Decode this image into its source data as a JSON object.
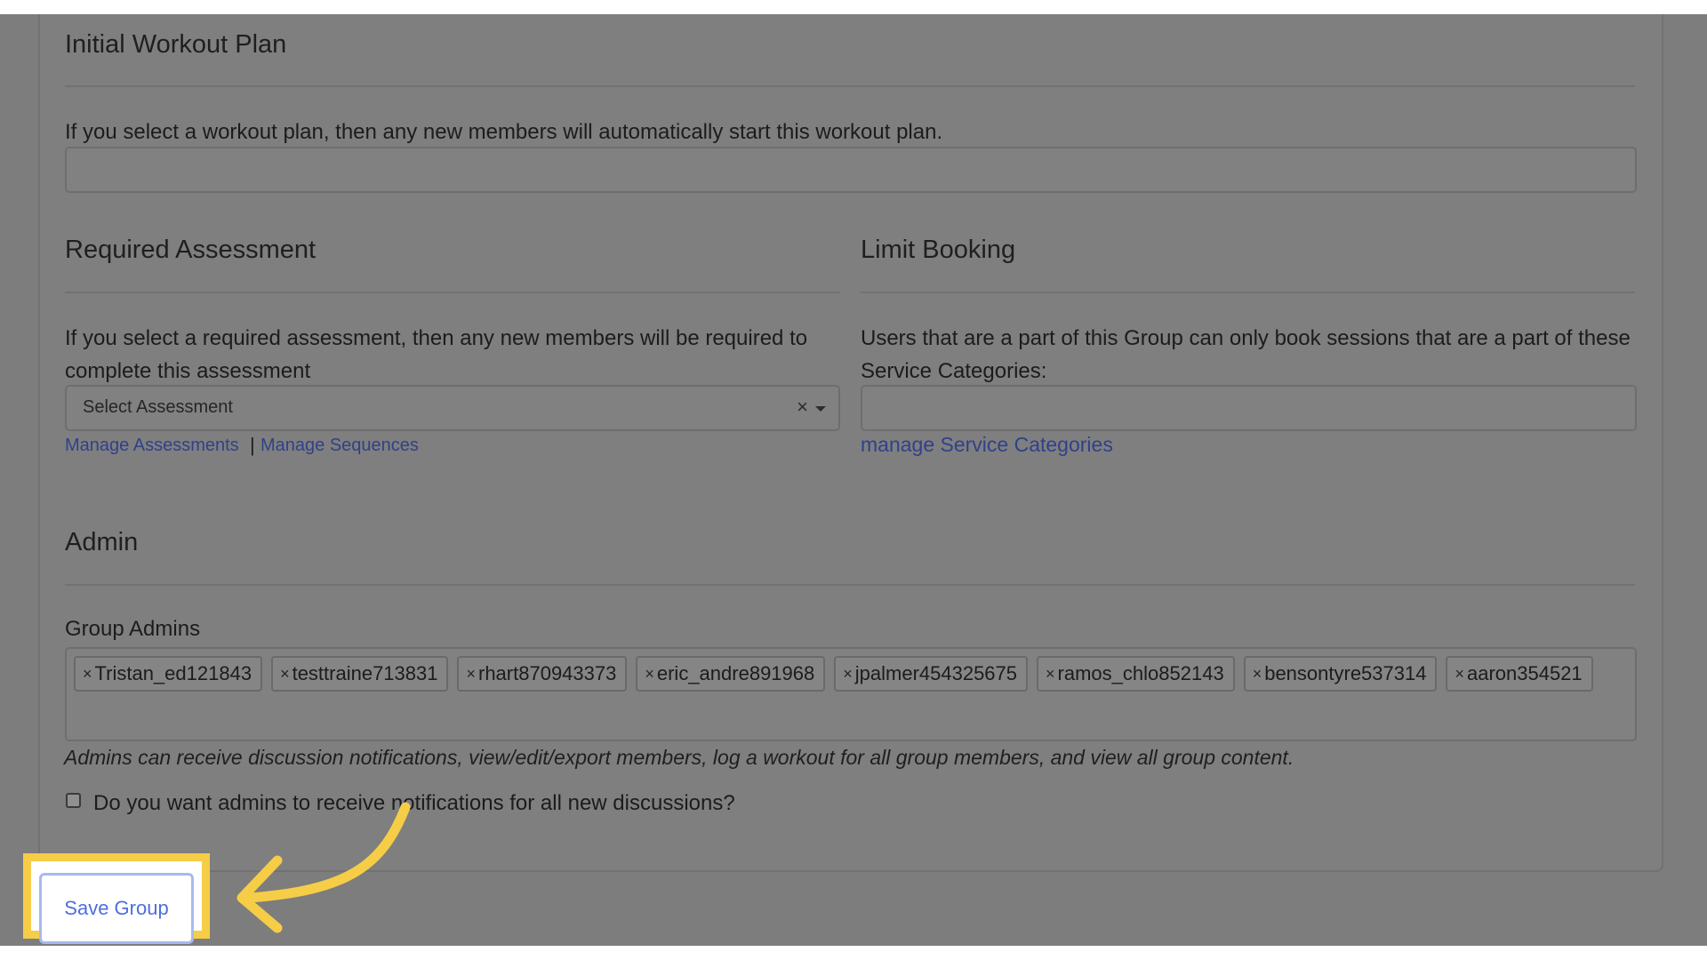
{
  "workout": {
    "heading": "Initial Workout Plan",
    "description": "If you select a workout plan, then any new members will automatically start this workout plan.",
    "input_value": ""
  },
  "assessment": {
    "heading": "Required Assessment",
    "description": "If you select a required assessment, then any new members will be required to complete this assessment",
    "select_placeholder": "Select Assessment",
    "clear_glyph": "×",
    "link_manage_assessments": "Manage Assessments",
    "separator": "|",
    "link_manage_sequences": "Manage Sequences"
  },
  "limit_booking": {
    "heading": "Limit Booking",
    "description": "Users that are a part of this Group can only book sessions that are a part of these Service Categories:",
    "input_value": "",
    "link_manage_service_categories": "manage Service Categories"
  },
  "admin": {
    "heading": "Admin",
    "group_admins_label": "Group Admins",
    "remove_glyph": "×",
    "tags": [
      "Tristan_ed121843",
      "testtraine713831",
      "rhart870943373",
      "eric_andre891968",
      "jpalmer454325675",
      "ramos_chlo852143",
      "bensontyre537314",
      "aaron354521"
    ],
    "note": "Admins can receive discussion notifications, view/edit/export members, log a workout for all group members, and view all group content.",
    "notify_checkbox_label": "Do you want admins to receive notifications for all new discussions?",
    "notify_checked": false
  },
  "footer": {
    "save_label": "Save Group"
  },
  "colors": {
    "overlay": "#7d7d7d",
    "highlight": "#f6cd46",
    "link": "#30418a",
    "save_text": "#4d6fdc"
  },
  "icons": {
    "caret": "chevron-down-icon",
    "annotation": "curved-arrow-icon"
  }
}
